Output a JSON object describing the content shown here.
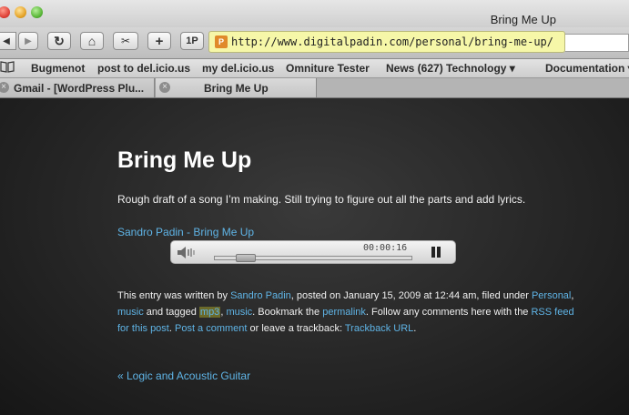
{
  "window": {
    "title": "Bring Me Up"
  },
  "toolbar": {
    "buttons": [
      "◀",
      "▶",
      "↻",
      "⌂",
      "✂",
      "+",
      "1P"
    ],
    "url": "http://www.digitalpadin.com/personal/bring-me-up/",
    "favicon": "P"
  },
  "bookmarks": {
    "icon": "book-icon",
    "items": [
      "Bugmenot",
      "post to del.icio.us",
      "my del.icio.us",
      "Omniture Tester",
      "News (627)",
      "Technology",
      "Documentation"
    ]
  },
  "tabs": [
    {
      "label": "Gmail - [WordPress Plu..."
    },
    {
      "label": "Bring Me Up"
    }
  ],
  "post": {
    "title": "Bring Me Up",
    "description": "Rough draft of a song I’m making. Still trying to figure out all the parts and add lyrics.",
    "audio_link": "Sandro Padin - Bring Me Up",
    "player": {
      "time": "00:00:16",
      "progress": 0.12
    },
    "meta": {
      "t1": "This entry was written by ",
      "author": "Sandro Padin",
      "t2": ", posted on January 15, 2009 at 12:44 am, filed under ",
      "category": "Personal",
      "t3": ",",
      "tag_music1": "music",
      "t4": " and tagged ",
      "tag_mp3": "mp3",
      "t5": ", ",
      "tag_music2": "music",
      "t6": ". Bookmark the ",
      "permalink": "permalink",
      "t7": ". Follow any comments here with the ",
      "rss": "RSS feed for this post",
      "t8": ". ",
      "post_comment": "Post a comment",
      "t9": " or leave a trackback: ",
      "trackback": "Trackback URL",
      "t10": "."
    },
    "prev_link": "« Logic and Acoustic Guitar"
  }
}
